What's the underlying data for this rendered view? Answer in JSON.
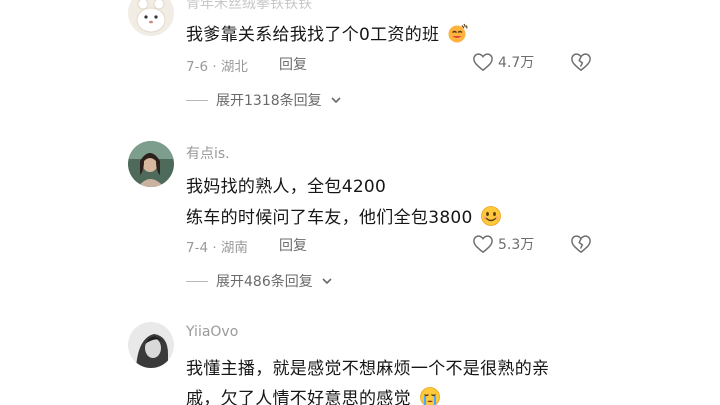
{
  "comments": [
    {
      "username": "青年禾丝绒拳铁铁铁",
      "lines": [
        "我爹靠关系给我找了个0工资的班"
      ],
      "date_location": "7-6 · 湖北",
      "reply_label": "回复",
      "likes": "4.7万",
      "expand_label": "展开1318条回复",
      "trailing_emoji": "face-with-sweat-icon"
    },
    {
      "username": "有点is.",
      "lines": [
        "我妈找的熟人，全包4200",
        "练车的时候问了车友，他们全包3800"
      ],
      "date_location": "7-4 · 湖南",
      "reply_label": "回复",
      "likes": "5.3万",
      "expand_label": "展开486条回复",
      "trailing_emoji": "smiling-face-icon"
    },
    {
      "username": "YiiaOvo",
      "lines": [
        "我懂主播，就是感觉不想麻烦一个不是很熟的亲",
        "戚，欠了人情不好意思的感觉"
      ],
      "trailing_emoji": "crying-face-icon"
    }
  ],
  "colors": {
    "text": "#161616",
    "meta": "#9a9a9a",
    "action": "#6e6e6e"
  }
}
